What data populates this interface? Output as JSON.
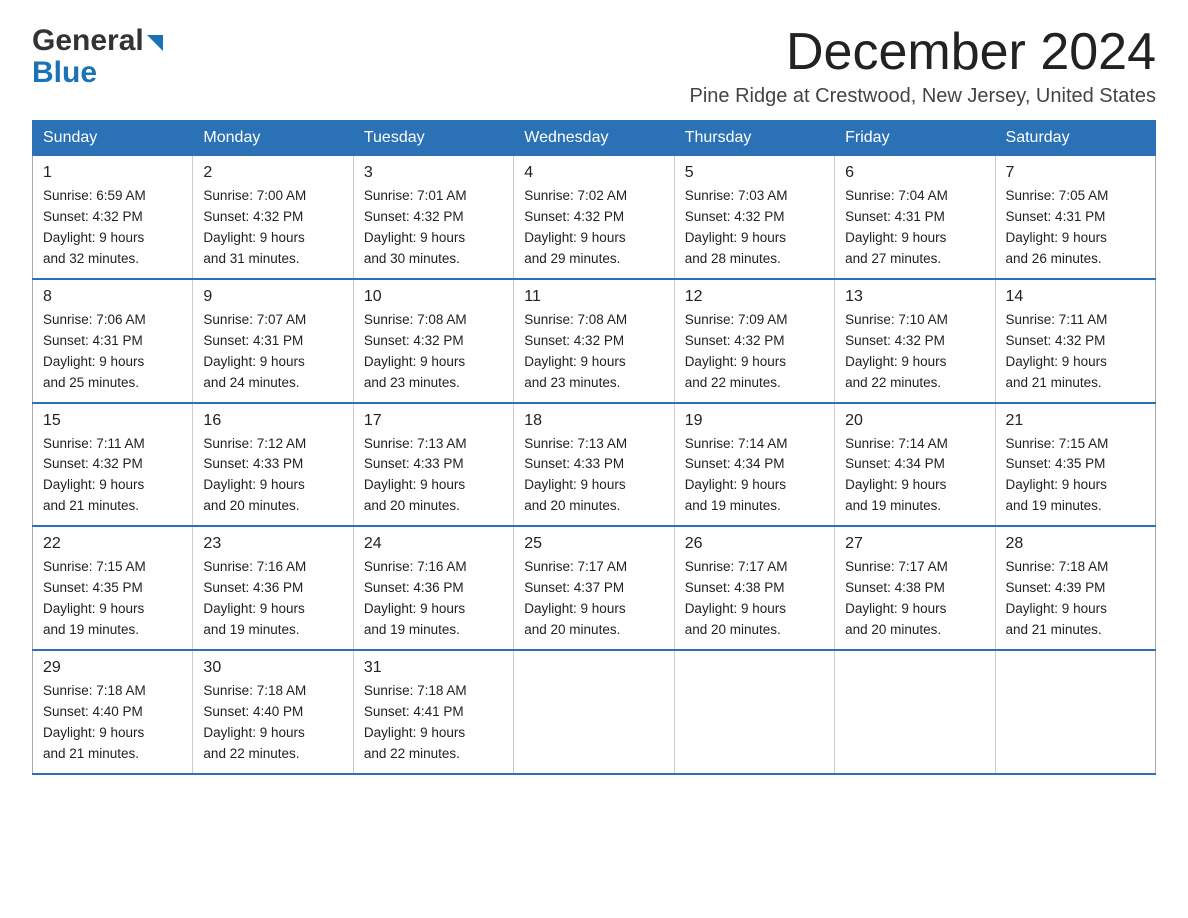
{
  "logo": {
    "general": "General",
    "blue": "Blue"
  },
  "header": {
    "title": "December 2024",
    "subtitle": "Pine Ridge at Crestwood, New Jersey, United States"
  },
  "weekdays": [
    "Sunday",
    "Monday",
    "Tuesday",
    "Wednesday",
    "Thursday",
    "Friday",
    "Saturday"
  ],
  "weeks": [
    [
      {
        "day": "1",
        "sunrise": "6:59 AM",
        "sunset": "4:32 PM",
        "daylight": "9 hours and 32 minutes."
      },
      {
        "day": "2",
        "sunrise": "7:00 AM",
        "sunset": "4:32 PM",
        "daylight": "9 hours and 31 minutes."
      },
      {
        "day": "3",
        "sunrise": "7:01 AM",
        "sunset": "4:32 PM",
        "daylight": "9 hours and 30 minutes."
      },
      {
        "day": "4",
        "sunrise": "7:02 AM",
        "sunset": "4:32 PM",
        "daylight": "9 hours and 29 minutes."
      },
      {
        "day": "5",
        "sunrise": "7:03 AM",
        "sunset": "4:32 PM",
        "daylight": "9 hours and 28 minutes."
      },
      {
        "day": "6",
        "sunrise": "7:04 AM",
        "sunset": "4:31 PM",
        "daylight": "9 hours and 27 minutes."
      },
      {
        "day": "7",
        "sunrise": "7:05 AM",
        "sunset": "4:31 PM",
        "daylight": "9 hours and 26 minutes."
      }
    ],
    [
      {
        "day": "8",
        "sunrise": "7:06 AM",
        "sunset": "4:31 PM",
        "daylight": "9 hours and 25 minutes."
      },
      {
        "day": "9",
        "sunrise": "7:07 AM",
        "sunset": "4:31 PM",
        "daylight": "9 hours and 24 minutes."
      },
      {
        "day": "10",
        "sunrise": "7:08 AM",
        "sunset": "4:32 PM",
        "daylight": "9 hours and 23 minutes."
      },
      {
        "day": "11",
        "sunrise": "7:08 AM",
        "sunset": "4:32 PM",
        "daylight": "9 hours and 23 minutes."
      },
      {
        "day": "12",
        "sunrise": "7:09 AM",
        "sunset": "4:32 PM",
        "daylight": "9 hours and 22 minutes."
      },
      {
        "day": "13",
        "sunrise": "7:10 AM",
        "sunset": "4:32 PM",
        "daylight": "9 hours and 22 minutes."
      },
      {
        "day": "14",
        "sunrise": "7:11 AM",
        "sunset": "4:32 PM",
        "daylight": "9 hours and 21 minutes."
      }
    ],
    [
      {
        "day": "15",
        "sunrise": "7:11 AM",
        "sunset": "4:32 PM",
        "daylight": "9 hours and 21 minutes."
      },
      {
        "day": "16",
        "sunrise": "7:12 AM",
        "sunset": "4:33 PM",
        "daylight": "9 hours and 20 minutes."
      },
      {
        "day": "17",
        "sunrise": "7:13 AM",
        "sunset": "4:33 PM",
        "daylight": "9 hours and 20 minutes."
      },
      {
        "day": "18",
        "sunrise": "7:13 AM",
        "sunset": "4:33 PM",
        "daylight": "9 hours and 20 minutes."
      },
      {
        "day": "19",
        "sunrise": "7:14 AM",
        "sunset": "4:34 PM",
        "daylight": "9 hours and 19 minutes."
      },
      {
        "day": "20",
        "sunrise": "7:14 AM",
        "sunset": "4:34 PM",
        "daylight": "9 hours and 19 minutes."
      },
      {
        "day": "21",
        "sunrise": "7:15 AM",
        "sunset": "4:35 PM",
        "daylight": "9 hours and 19 minutes."
      }
    ],
    [
      {
        "day": "22",
        "sunrise": "7:15 AM",
        "sunset": "4:35 PM",
        "daylight": "9 hours and 19 minutes."
      },
      {
        "day": "23",
        "sunrise": "7:16 AM",
        "sunset": "4:36 PM",
        "daylight": "9 hours and 19 minutes."
      },
      {
        "day": "24",
        "sunrise": "7:16 AM",
        "sunset": "4:36 PM",
        "daylight": "9 hours and 19 minutes."
      },
      {
        "day": "25",
        "sunrise": "7:17 AM",
        "sunset": "4:37 PM",
        "daylight": "9 hours and 20 minutes."
      },
      {
        "day": "26",
        "sunrise": "7:17 AM",
        "sunset": "4:38 PM",
        "daylight": "9 hours and 20 minutes."
      },
      {
        "day": "27",
        "sunrise": "7:17 AM",
        "sunset": "4:38 PM",
        "daylight": "9 hours and 20 minutes."
      },
      {
        "day": "28",
        "sunrise": "7:18 AM",
        "sunset": "4:39 PM",
        "daylight": "9 hours and 21 minutes."
      }
    ],
    [
      {
        "day": "29",
        "sunrise": "7:18 AM",
        "sunset": "4:40 PM",
        "daylight": "9 hours and 21 minutes."
      },
      {
        "day": "30",
        "sunrise": "7:18 AM",
        "sunset": "4:40 PM",
        "daylight": "9 hours and 22 minutes."
      },
      {
        "day": "31",
        "sunrise": "7:18 AM",
        "sunset": "4:41 PM",
        "daylight": "9 hours and 22 minutes."
      },
      null,
      null,
      null,
      null
    ]
  ]
}
